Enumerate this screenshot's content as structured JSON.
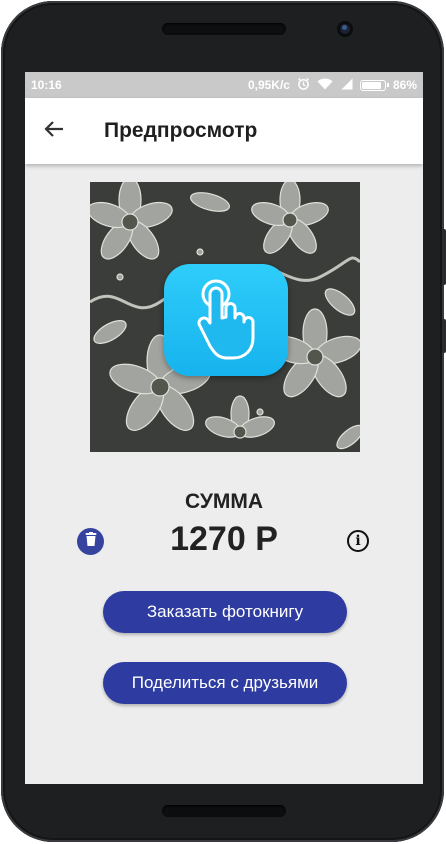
{
  "status_bar": {
    "time": "10:16",
    "speed": "0,95K/c",
    "battery": "86%",
    "icons": [
      "alarm-icon",
      "wifi-icon",
      "signal-icon",
      "battery-icon"
    ]
  },
  "app_bar": {
    "back_icon": "arrow-back-icon",
    "title": "Предпросмотр"
  },
  "preview": {
    "overlay_icon": "tap-gesture-icon",
    "accent": "#1fbdf3"
  },
  "summary": {
    "label": "СУММА",
    "value": "1270 Р",
    "delete_icon": "trash-icon",
    "info_icon": "info-icon"
  },
  "buttons": {
    "order_label": "Заказать фотокнигу",
    "share_label": "Поделиться с друзьями"
  },
  "colors": {
    "primary": "#2e3ba0",
    "background": "#ededed",
    "status_bar": "#c9c9c9"
  }
}
